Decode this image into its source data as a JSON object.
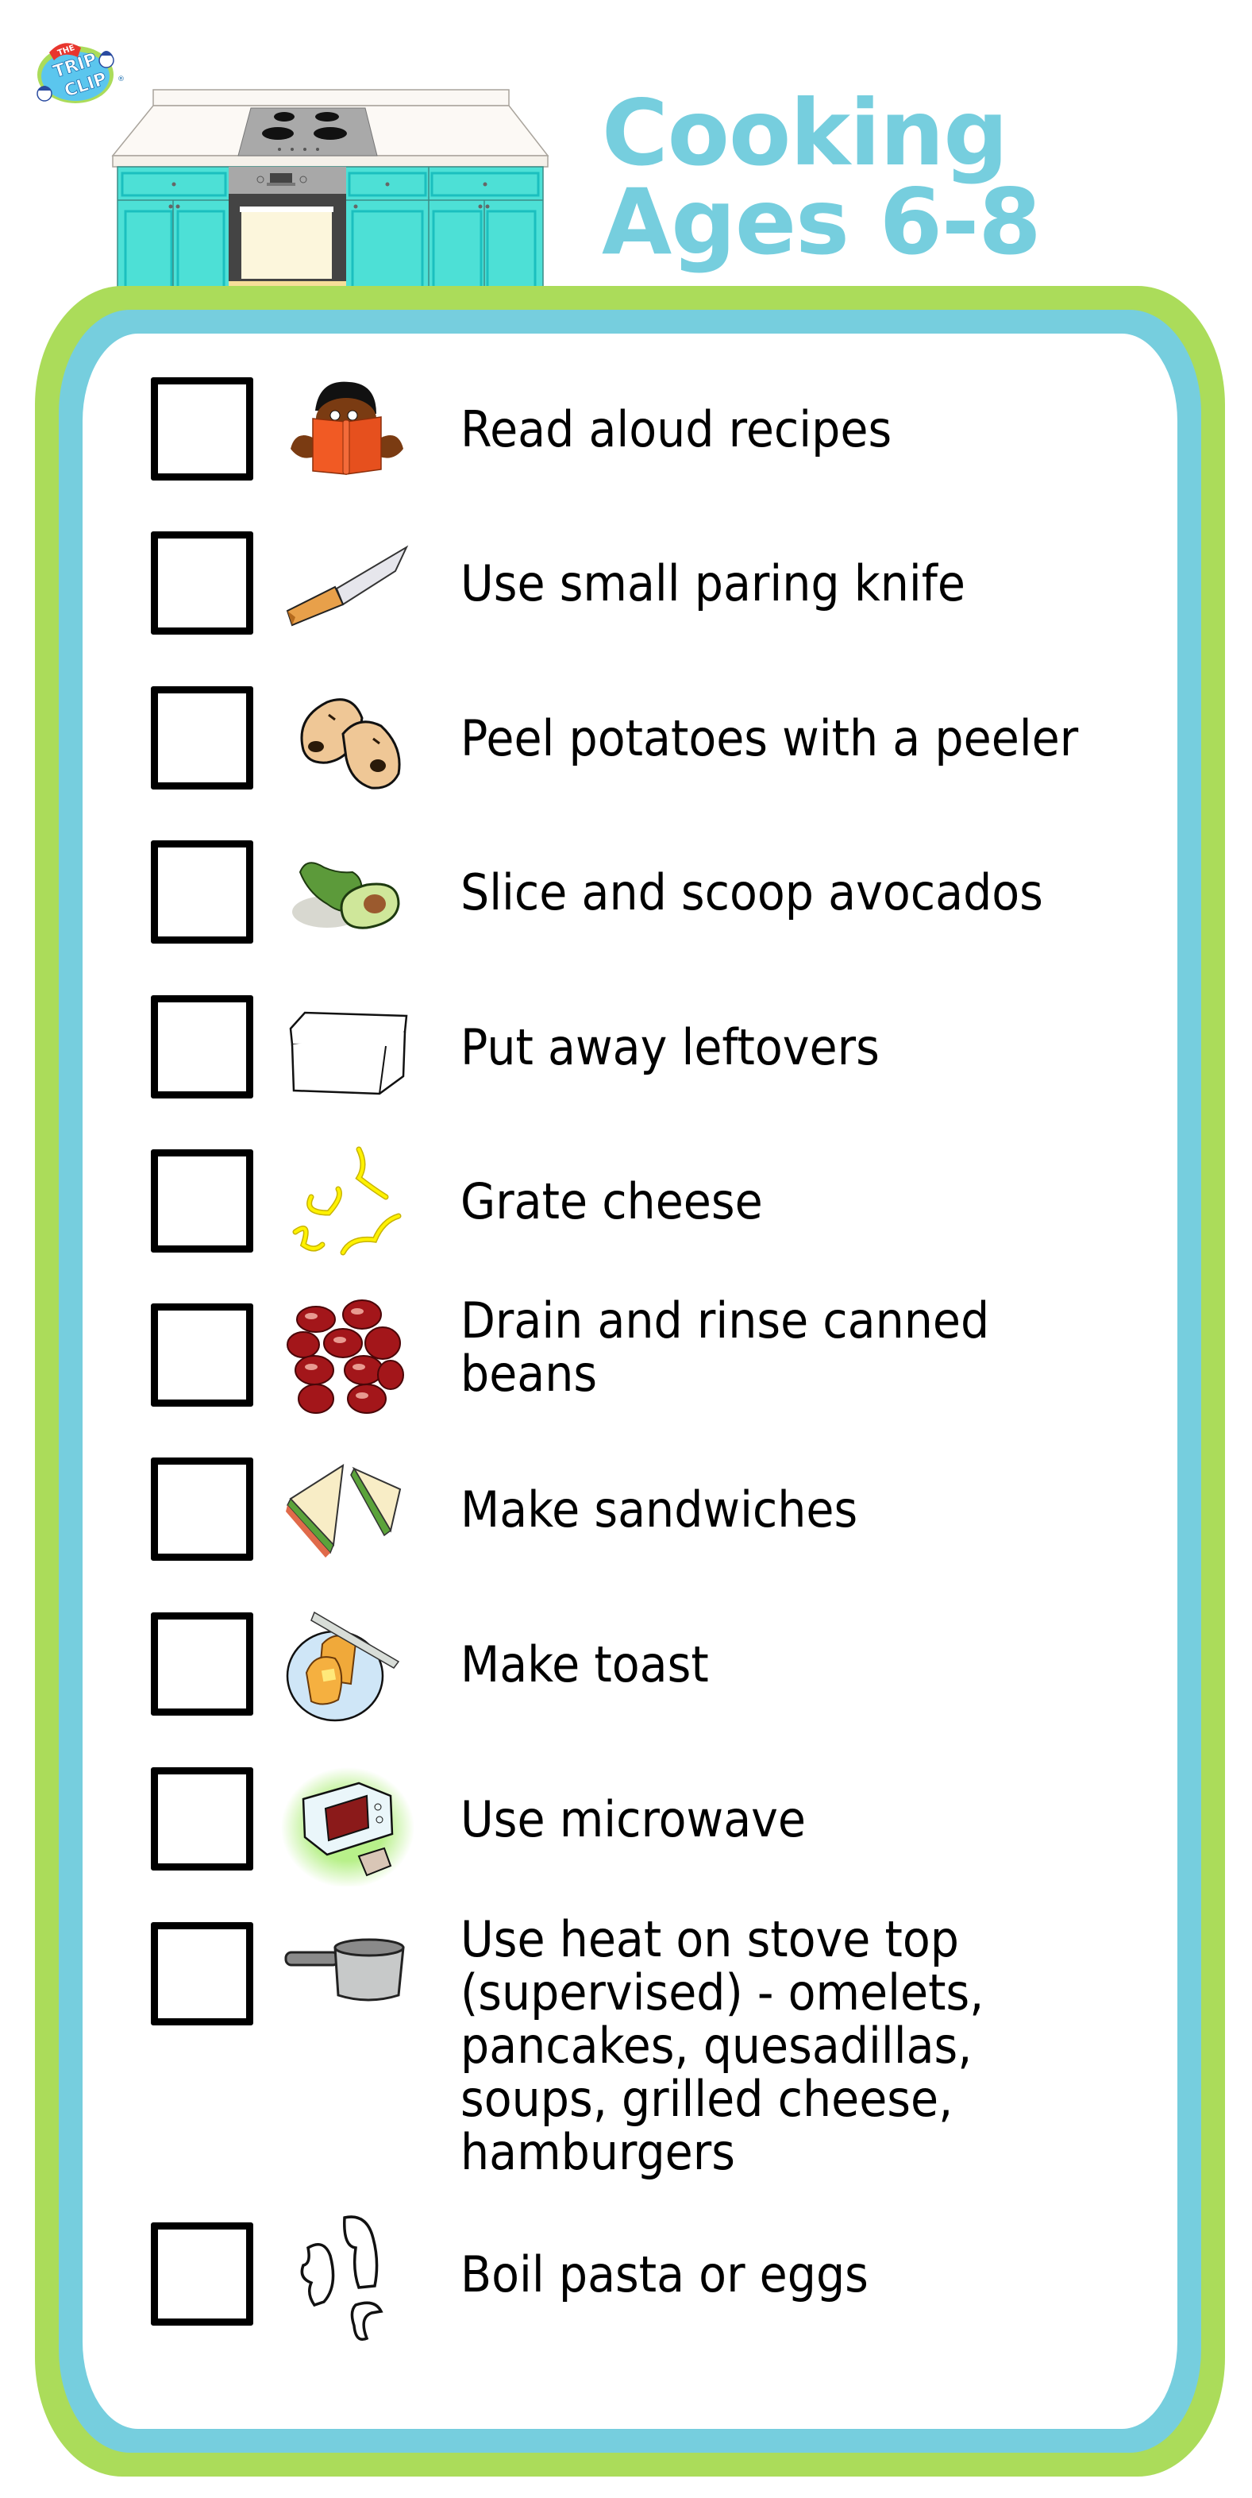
{
  "brand": {
    "logo_top": "THE",
    "logo_line1": "TRIP",
    "logo_line2": "CLIP",
    "registered_mark": "®"
  },
  "header": {
    "title_line1": "Cooking",
    "title_line2": "Ages 6-8",
    "illustration": "kitchen-counter-with-stove-and-cabinets"
  },
  "colors": {
    "title": "#76CEDE",
    "outer_border": "#ABDC5A",
    "inner_border": "#76CEDE",
    "cabinet": "#4DE0D6"
  },
  "checklist": {
    "items": [
      {
        "label": "Read aloud recipes",
        "icon": "reading-child-icon",
        "checked": false
      },
      {
        "label": "Use small paring knife",
        "icon": "knife-icon",
        "checked": false
      },
      {
        "label": "Peel potatoes with a peeler",
        "icon": "potatoes-icon",
        "checked": false
      },
      {
        "label": "Slice and scoop avocados",
        "icon": "avocado-icon",
        "checked": false
      },
      {
        "label": "Put away leftovers",
        "icon": "container-icon",
        "checked": false
      },
      {
        "label": "Grate cheese",
        "icon": "grated-cheese-icon",
        "checked": false
      },
      {
        "label": "Drain and rinse canned beans",
        "icon": "beans-icon",
        "checked": false
      },
      {
        "label": "Make sandwiches",
        "icon": "sandwich-icon",
        "checked": false
      },
      {
        "label": "Make toast",
        "icon": "toast-icon",
        "checked": false
      },
      {
        "label": "Use microwave",
        "icon": "microwave-icon",
        "checked": false
      },
      {
        "label": "Use heat on stove top (supervised) - omelets, pancakes, quesadillas, soups, grilled cheese, hamburgers",
        "icon": "saucepan-icon",
        "checked": false
      },
      {
        "label": "Boil pasta or eggs",
        "icon": "pasta-icon",
        "checked": false
      }
    ]
  }
}
